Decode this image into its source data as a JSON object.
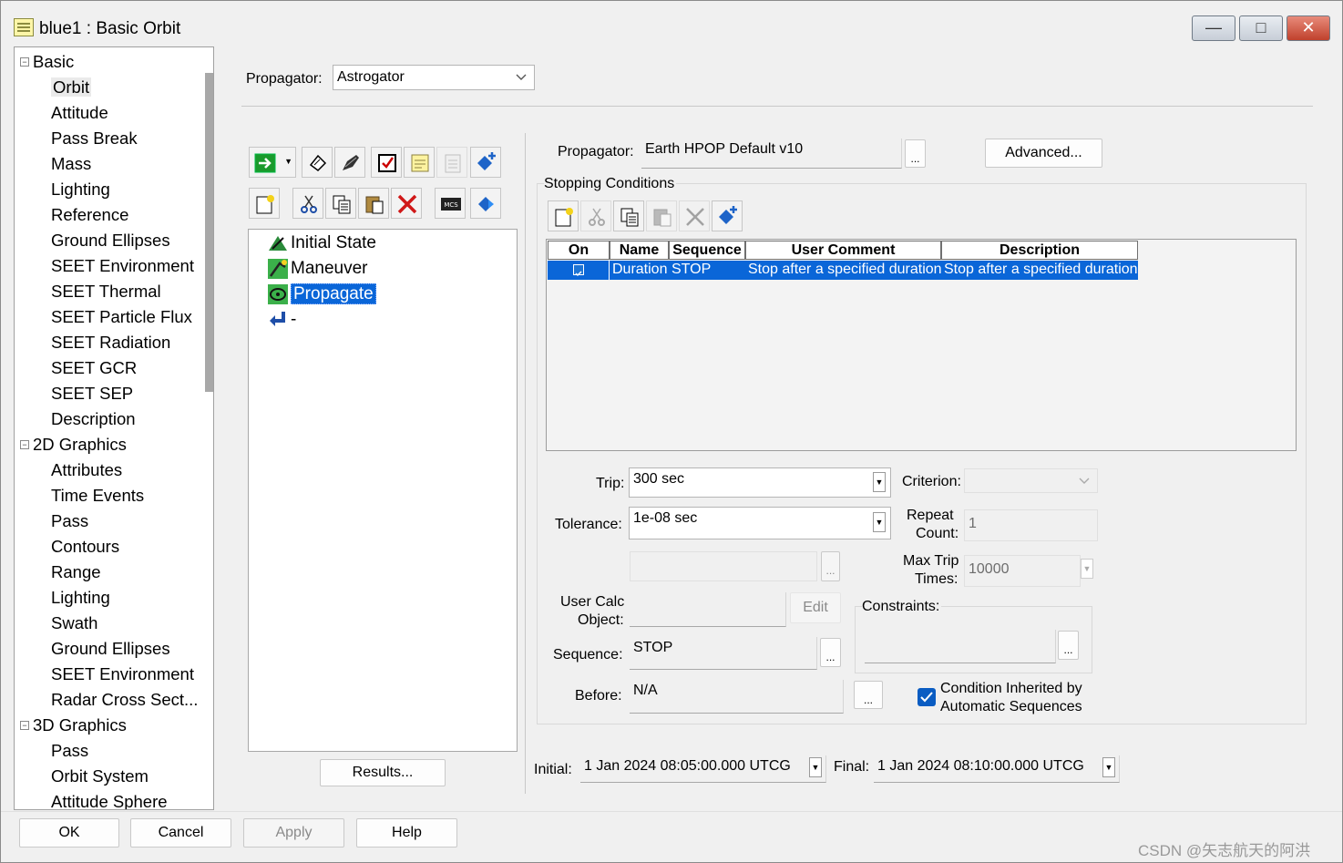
{
  "window": {
    "title": "blue1 : Basic Orbit",
    "controls": {
      "minimize": "—",
      "maximize": "□",
      "close": "✕"
    }
  },
  "tree": {
    "groups": [
      {
        "label": "Basic",
        "children": [
          "Orbit",
          "Attitude",
          "Pass Break",
          "Mass",
          "Lighting",
          "Reference",
          "Ground Ellipses",
          "SEET Environment",
          "SEET Thermal",
          "SEET Particle Flux",
          "SEET Radiation",
          "SEET GCR",
          "SEET SEP",
          "Description"
        ]
      },
      {
        "label": "2D Graphics",
        "children": [
          "Attributes",
          "Time Events",
          "Pass",
          "Contours",
          "Range",
          "Lighting",
          "Swath",
          "Ground Ellipses",
          "SEET Environment",
          "Radar Cross Sect..."
        ]
      },
      {
        "label": "3D Graphics",
        "children": [
          "Pass",
          "Orbit System",
          "Attitude Sphere"
        ]
      }
    ],
    "selected": "Orbit"
  },
  "top": {
    "propagator_label": "Propagator:",
    "propagator_value": "Astrogator"
  },
  "mcs": {
    "items": [
      "Initial State",
      "Maneuver",
      "Propagate",
      "-"
    ],
    "selected": "Propagate",
    "results_button": "Results..."
  },
  "segment": {
    "propagator_label": "Propagator:",
    "propagator_value": "Earth HPOP Default v10",
    "ellipsis": "...",
    "advanced_button": "Advanced...",
    "stopping_conditions_label": "Stopping Conditions",
    "grid": {
      "columns": [
        "On",
        "Name",
        "Sequence",
        "User Comment",
        "Description"
      ],
      "rows": [
        {
          "on": true,
          "name": "Duration",
          "sequence": "STOP",
          "user_comment": "Stop after a specified duration",
          "description": "Stop after a specified duration"
        }
      ]
    },
    "trip_label": "Trip:",
    "trip_value": "300 sec",
    "tolerance_label": "Tolerance:",
    "tolerance_value": "1e-08 sec",
    "criterion_label": "Criterion:",
    "repeat_label_1": "Repeat",
    "repeat_label_2": "Count:",
    "repeat_value": "1",
    "maxtrip_label_1": "Max Trip",
    "maxtrip_label_2": "Times:",
    "maxtrip_value": "10000",
    "usercalc_label_1": "User Calc",
    "usercalc_label_2": "Object:",
    "edit_button": "Edit",
    "constraints_label": "Constraints:",
    "sequence_label": "Sequence:",
    "sequence_value": "STOP",
    "before_label": "Before:",
    "before_value": "N/A",
    "inherited_label_1": "Condition Inherited by",
    "inherited_label_2": "Automatic Sequences",
    "inherited_checked": true
  },
  "times": {
    "initial_label": "Initial:",
    "initial_value": "1 Jan 2024 08:05:00.000 UTCG",
    "final_label": "Final:",
    "final_value": "1 Jan 2024 08:10:00.000 UTCG"
  },
  "footer": {
    "ok": "OK",
    "cancel": "Cancel",
    "apply": "Apply",
    "help": "Help"
  },
  "watermark": "CSDN @矢志航天的阿洪",
  "colors": {
    "selection": "#0a66d8",
    "close_button": "#c0412c"
  }
}
